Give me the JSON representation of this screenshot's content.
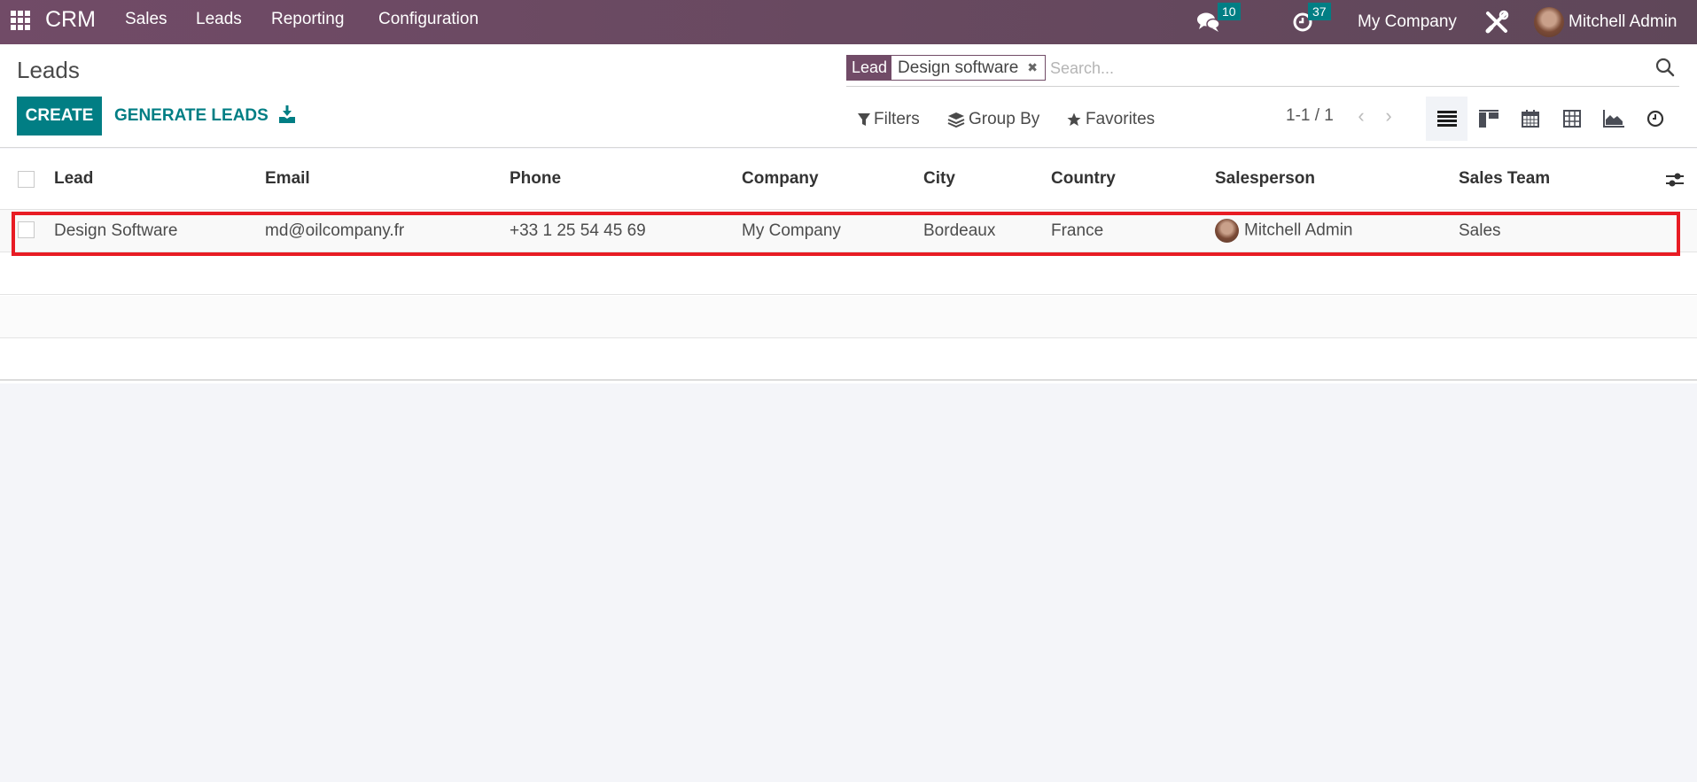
{
  "navbar": {
    "app_name": "CRM",
    "menu": [
      "Sales",
      "Leads",
      "Reporting",
      "Configuration"
    ],
    "messages_count": "10",
    "activities_count": "37",
    "company": "My Company",
    "user": "Mitchell Admin",
    "icons": {
      "apps": "apps-grid-icon",
      "messages": "chat-bubbles-icon",
      "activities": "clock-icon",
      "debug": "tools-icon",
      "avatar": "user-avatar"
    }
  },
  "control_panel": {
    "title": "Leads",
    "create_label": "CREATE",
    "generate_label": "GENERATE LEADS",
    "download_icon": "download-icon",
    "search": {
      "facet_label": "Lead",
      "facet_value": "Design software",
      "placeholder": "Search..."
    },
    "filters_label": "Filters",
    "groupby_label": "Group By",
    "favorites_label": "Favorites",
    "pager": "1-1 / 1",
    "views": [
      "list",
      "kanban",
      "calendar",
      "pivot",
      "graph",
      "activity"
    ],
    "active_view": "list"
  },
  "table": {
    "columns": [
      "Lead",
      "Email",
      "Phone",
      "Company",
      "City",
      "Country",
      "Salesperson",
      "Sales Team"
    ],
    "rows": [
      {
        "lead": "Design Software",
        "email": "md@oilcompany.fr",
        "phone": "+33 1 25 54 45 69",
        "company": "My Company",
        "city": "Bordeaux",
        "country": "France",
        "salesperson": "Mitchell Admin",
        "sales_team": "Sales"
      }
    ]
  },
  "colors": {
    "brand": "#714b67",
    "accent": "#017e84",
    "highlight": "#e81c24"
  }
}
